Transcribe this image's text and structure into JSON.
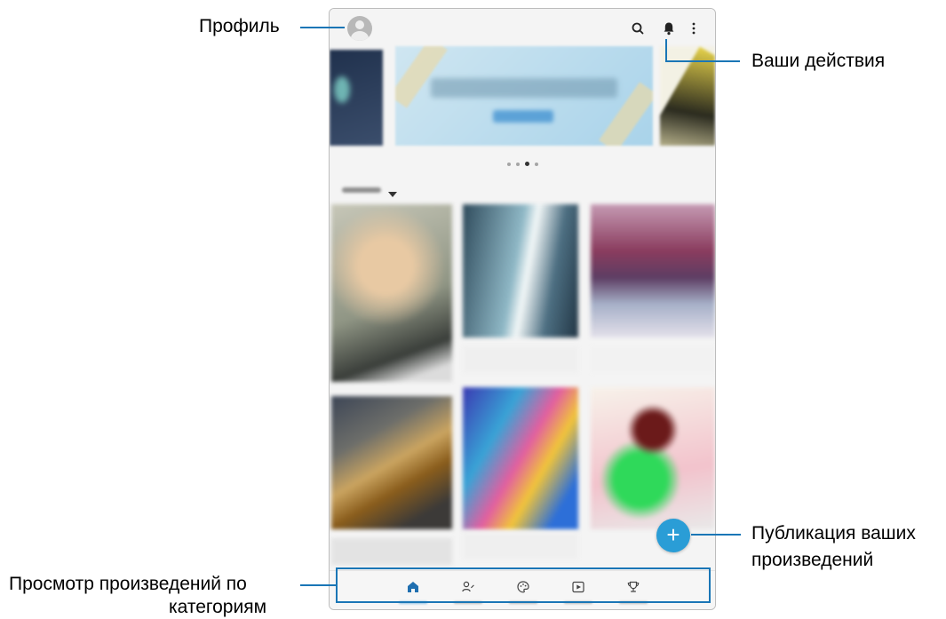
{
  "annotations": {
    "profile": "Профиль",
    "your_actions": "Ваши действия",
    "publish_line1": "Публикация ваших",
    "publish_line2": "произведений",
    "browse_line1": "Просмотр произведений по",
    "browse_line2": "категориям"
  },
  "carousel": {
    "slide_count": 4,
    "active_index": 2
  },
  "fab": {
    "symbol": "+"
  },
  "bottom_nav": {
    "items": [
      {
        "icon": "home-icon",
        "active": true
      },
      {
        "icon": "artist-icon",
        "active": false
      },
      {
        "icon": "palette-icon",
        "active": false
      },
      {
        "icon": "video-icon",
        "active": false
      },
      {
        "icon": "trophy-icon",
        "active": false
      }
    ]
  },
  "colors": {
    "accent": "#1a76b6",
    "fab": "#2a9dd6",
    "background": "#f4f4f4"
  }
}
